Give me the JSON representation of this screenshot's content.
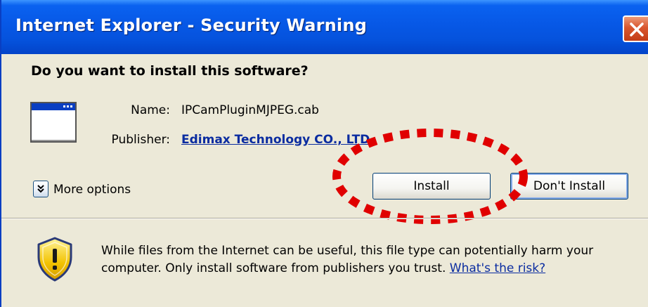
{
  "window": {
    "title": "Internet Explorer - Security Warning"
  },
  "prompt": {
    "question": "Do you want to install this software?"
  },
  "file": {
    "name_label": "Name:",
    "name_value": "IPCamPluginMJPEG.cab",
    "publisher_label": "Publisher:",
    "publisher_value": "Edimax Technology CO., LTD."
  },
  "options": {
    "more_label": "More options"
  },
  "buttons": {
    "install": "Install",
    "dont_install": "Don't Install"
  },
  "warning": {
    "text": "While files from the Internet can be useful, this file type can potentially harm your computer. Only install software from publishers you trust.",
    "risk_link": "What's the risk?"
  },
  "annotation": {
    "highlight_color": "#e00000"
  },
  "icons": [
    "close-icon",
    "application-window-icon",
    "chevron-down-icon",
    "security-shield-icon"
  ]
}
